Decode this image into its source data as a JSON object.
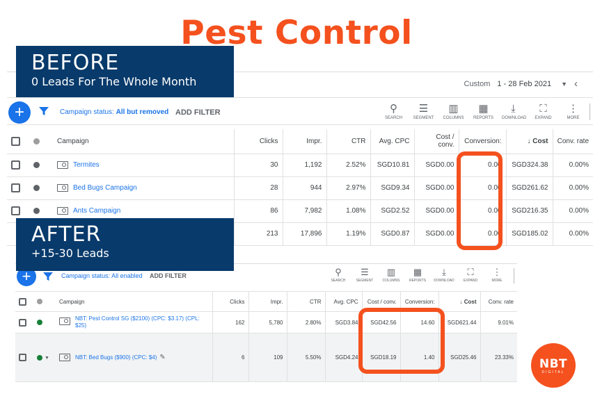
{
  "headline": "Pest Control",
  "before_label": {
    "title": "BEFORE",
    "subtitle": "0 Leads For The Whole Month"
  },
  "after_label": {
    "title": "AFTER",
    "subtitle": "+15-30 Leads"
  },
  "date_bar": {
    "prefix": "Custom",
    "range": "1 - 28 Feb 2021"
  },
  "toolbar": {
    "status_prefix": "Campaign status:",
    "status_value": "All but removed",
    "add_filter": "ADD FILTER",
    "tools": [
      "SEARCH",
      "SEGMENT",
      "COLUMNS",
      "REPORTS",
      "DOWNLOAD",
      "EXPAND",
      "MORE"
    ]
  },
  "before_table": {
    "headers": [
      "Campaign",
      "Clicks",
      "Impr.",
      "CTR",
      "Avg. CPC",
      "Cost / conv.",
      "Conversion:",
      "Cost",
      "Conv. rate"
    ],
    "rows": [
      {
        "campaign": "Termites",
        "clicks": "30",
        "impr": "1,192",
        "ctr": "2.52%",
        "cpc": "SGD10.81",
        "cost_conv": "SGD0.00",
        "conv": "0.00",
        "cost": "SGD324.38",
        "rate": "0.00%"
      },
      {
        "campaign": "Bed Bugs Campaign",
        "clicks": "28",
        "impr": "944",
        "ctr": "2.97%",
        "cpc": "SGD9.34",
        "cost_conv": "SGD0.00",
        "conv": "0.00",
        "cost": "SGD261.62",
        "rate": "0.00%"
      },
      {
        "campaign": "Ants Campaign",
        "clicks": "86",
        "impr": "7,982",
        "ctr": "1.08%",
        "cpc": "SGD2.52",
        "cost_conv": "SGD0.00",
        "conv": "0.00",
        "cost": "SGD216.35",
        "rate": "0.00%"
      },
      {
        "campaign": "",
        "clicks": "213",
        "impr": "17,896",
        "ctr": "1.19%",
        "cpc": "SGD0.87",
        "cost_conv": "SGD0.00",
        "conv": "0.00",
        "cost": "SGD185.02",
        "rate": "0.00%"
      }
    ]
  },
  "after_toolbar": {
    "status_prefix": "Campaign status:",
    "status_value": "All enabled",
    "add_filter": "ADD FILTER"
  },
  "after_table": {
    "headers": [
      "Campaign",
      "Clicks",
      "Impr.",
      "CTR",
      "Avg. CPC",
      "Cost / conv.",
      "Conversion:",
      "Cost",
      "Conv. rate"
    ],
    "rows": [
      {
        "campaign": "NBT: Pest Control SG ($2100) (CPC: $3.17) (CPL: $25)",
        "clicks": "162",
        "impr": "5,780",
        "ctr": "2.80%",
        "cpc": "SGD3.84",
        "cost_conv": "SGD42.56",
        "conv": "14.60",
        "cost": "SGD621.44",
        "rate": "9.01%"
      },
      {
        "campaign": "NBT: Bed Bugs ($900) (CPC: $4)",
        "clicks": "6",
        "impr": "109",
        "ctr": "5.50%",
        "cpc": "SGD4.24",
        "cost_conv": "SGD18.19",
        "conv": "1.40",
        "cost": "SGD25.46",
        "rate": "23.33%"
      }
    ]
  },
  "logo": {
    "line1": "NBT",
    "line2": "DIGITAL"
  },
  "colors": {
    "accent": "#f4511e",
    "label_bg": "#083a6b",
    "link": "#1a73e8"
  }
}
